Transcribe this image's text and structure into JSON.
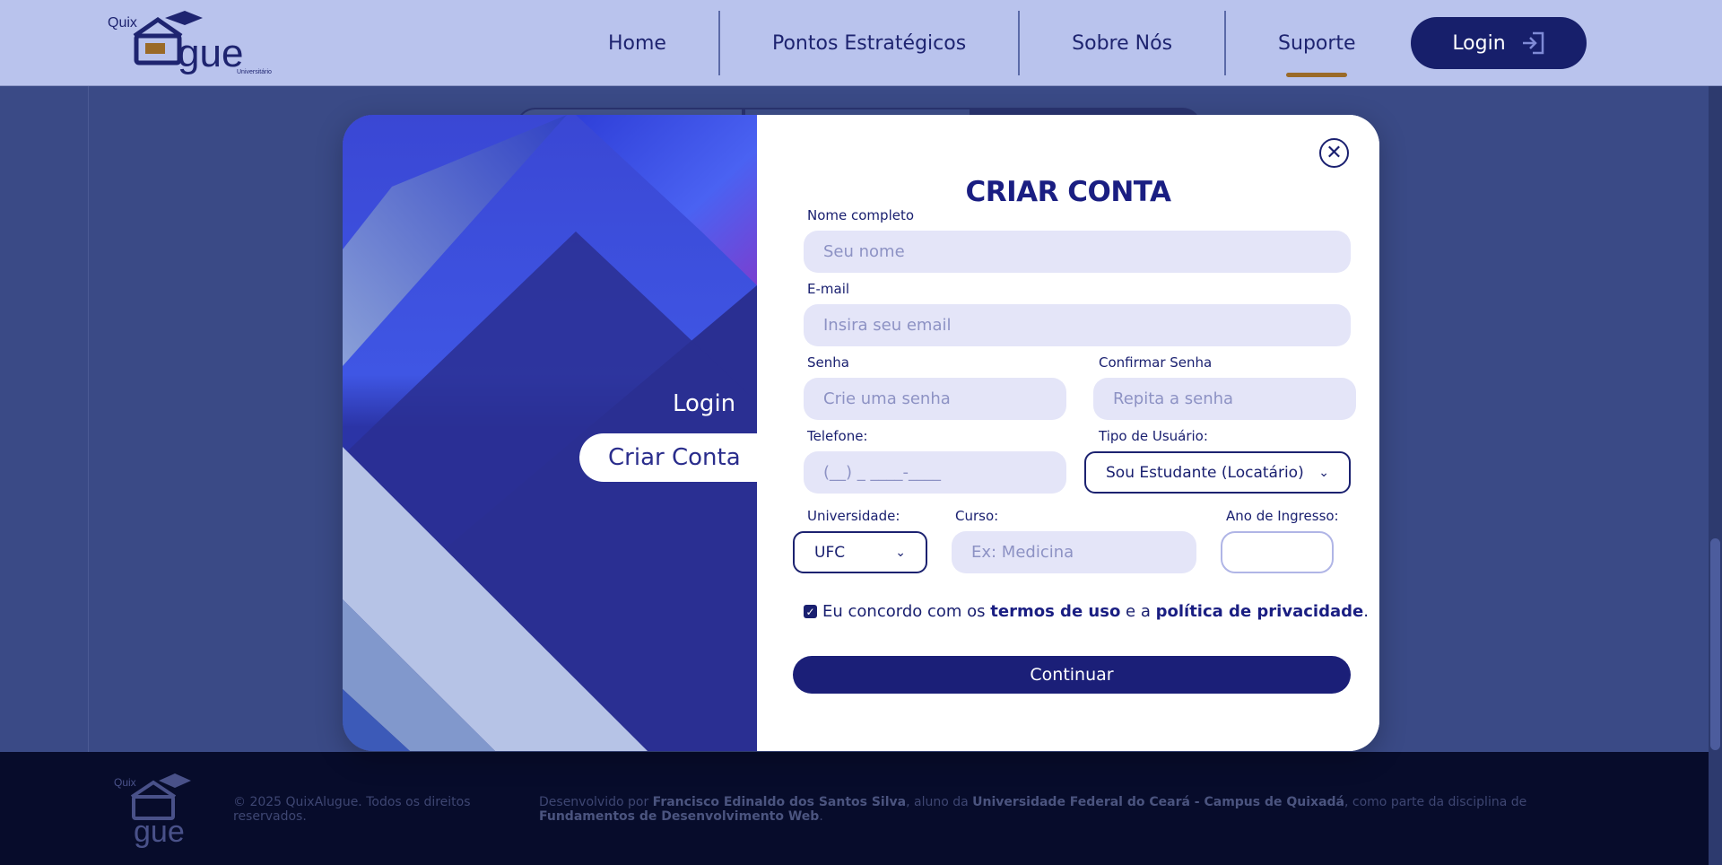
{
  "header": {
    "logo_alt": "QuixAlugue Universitário",
    "logo_text_top": "Quix",
    "logo_text_main": "Alugue",
    "nav": [
      {
        "label": "Home"
      },
      {
        "label": "Pontos Estratégicos"
      },
      {
        "label": "Sobre Nós"
      },
      {
        "label": "Suporte"
      }
    ],
    "login_label": "Login"
  },
  "modal": {
    "side_tabs": {
      "login": "Login",
      "create": "Criar Conta"
    },
    "title": "CRIAR CONTA",
    "fields": {
      "name": {
        "label": "Nome completo",
        "placeholder": "Seu nome"
      },
      "email": {
        "label": "E-mail",
        "placeholder": "Insira seu email"
      },
      "password": {
        "label": "Senha",
        "placeholder": "Crie uma senha"
      },
      "confirm": {
        "label": "Confirmar Senha",
        "placeholder": "Repita a senha"
      },
      "phone": {
        "label": "Telefone:",
        "placeholder": "(__) _ ____-____"
      },
      "user_type": {
        "label": "Tipo de Usuário:",
        "value": "Sou Estudante (Locatário)"
      },
      "university": {
        "label": "Universidade:",
        "value": "UFC"
      },
      "course": {
        "label": "Curso:",
        "placeholder": "Ex: Medicina"
      },
      "year": {
        "label": "Ano de Ingresso:",
        "value": ""
      }
    },
    "agree": {
      "prefix": "Eu concordo com os",
      "terms": "termos de uso",
      "middle": "e a",
      "privacy": "política de privacidade",
      "suffix": ".",
      "checked": true
    },
    "continue_label": "Continuar"
  },
  "footer": {
    "copyright": "© 2025 QuixAlugue. Todos os direitos reservados.",
    "credits_prefix": "Desenvolvido por",
    "author": "Francisco Edinaldo dos Santos Silva",
    "credits_mid1": ", aluno da",
    "university": "Universidade Federal do Ceará - Campus de Quixadá",
    "credits_mid2": ", como parte da disciplina de",
    "course": "Fundamentos de Desenvolvimento Web",
    "credits_end": "."
  },
  "colors": {
    "brand_dark": "#1b1f78",
    "header_bg": "#b9c3ed",
    "nav_active_underline": "#9a6a28",
    "footer_bg": "#070c2b"
  }
}
